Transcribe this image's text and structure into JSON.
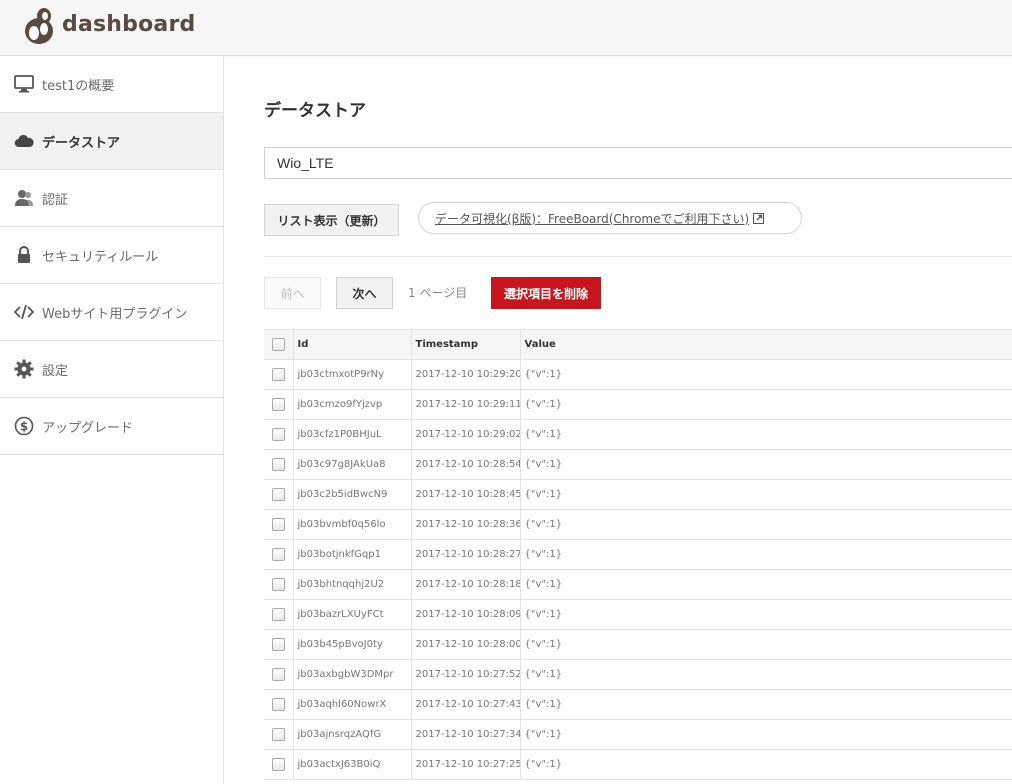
{
  "header": {
    "logo_text": "dashboard"
  },
  "sidebar": {
    "items": [
      {
        "label": "test1の概要",
        "icon": "monitor-icon",
        "active": false
      },
      {
        "label": "データストア",
        "icon": "cloud-icon",
        "active": true
      },
      {
        "label": "認証",
        "icon": "users-icon",
        "active": false
      },
      {
        "label": "セキュリティルール",
        "icon": "lock-icon",
        "active": false
      },
      {
        "label": "Webサイト用プラグイン",
        "icon": "code-icon",
        "active": false
      },
      {
        "label": "設定",
        "icon": "gear-icon",
        "active": false
      },
      {
        "label": "アップグレード",
        "icon": "dollar-icon",
        "active": false
      }
    ]
  },
  "main": {
    "title": "データストア",
    "collection_value": "Wio_LTE",
    "refresh_label": "リスト表示（更新）",
    "freeboard_label": "データ可視化(β版)：FreeBoard(Chromeでご利用下さい)",
    "prev_label": "前へ",
    "next_label": "次へ",
    "page_indicator": "1 ページ目",
    "delete_label": "選択項目を削除"
  },
  "table": {
    "columns": [
      "Id",
      "Timestamp",
      "Value"
    ],
    "rows": [
      {
        "id": "jb03ctmxotP9rNy",
        "timestamp": "2017-12-10 10:29:20",
        "value": "{\"v\":1}"
      },
      {
        "id": "jb03cmzo9fYjzvp",
        "timestamp": "2017-12-10 10:29:11",
        "value": "{\"v\":1}"
      },
      {
        "id": "jb03cfz1P0BHJuL",
        "timestamp": "2017-12-10 10:29:02",
        "value": "{\"v\":1}"
      },
      {
        "id": "jb03c97g8JAkUa8",
        "timestamp": "2017-12-10 10:28:54",
        "value": "{\"v\":1}"
      },
      {
        "id": "jb03c2b5idBwcN9",
        "timestamp": "2017-12-10 10:28:45",
        "value": "{\"v\":1}"
      },
      {
        "id": "jb03bvmbf0q56lo",
        "timestamp": "2017-12-10 10:28:36",
        "value": "{\"v\":1}"
      },
      {
        "id": "jb03botjnkfGqp1",
        "timestamp": "2017-12-10 10:28:27",
        "value": "{\"v\":1}"
      },
      {
        "id": "jb03bhtnqqhj2U2",
        "timestamp": "2017-12-10 10:28:18",
        "value": "{\"v\":1}"
      },
      {
        "id": "jb03bazrLXUyFCt",
        "timestamp": "2017-12-10 10:28:09",
        "value": "{\"v\":1}"
      },
      {
        "id": "jb03b45pBvoJ0ty",
        "timestamp": "2017-12-10 10:28:00",
        "value": "{\"v\":1}"
      },
      {
        "id": "jb03axbgbW3DMpr",
        "timestamp": "2017-12-10 10:27:52",
        "value": "{\"v\":1}"
      },
      {
        "id": "jb03aqhl60NowrX",
        "timestamp": "2017-12-10 10:27:43",
        "value": "{\"v\":1}"
      },
      {
        "id": "jb03ajnsrqzAQfG",
        "timestamp": "2017-12-10 10:27:34",
        "value": "{\"v\":1}"
      },
      {
        "id": "jb03actxJ63B0iQ",
        "timestamp": "2017-12-10 10:27:25",
        "value": "{\"v\":1}"
      }
    ]
  },
  "colors": {
    "brand": "#5a4a42",
    "danger": "#c8161d",
    "active_nav_bg": "#f2f2f2"
  }
}
